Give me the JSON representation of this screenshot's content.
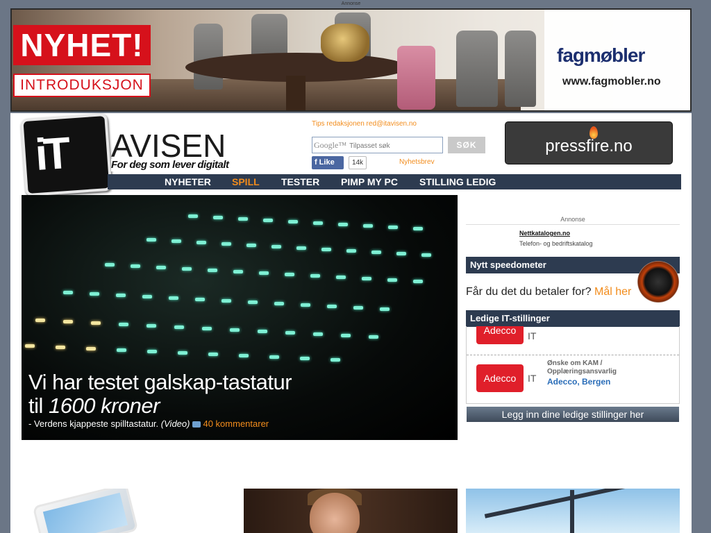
{
  "top_ad_label": "Annonse",
  "banner": {
    "headline": "NYHET!",
    "tagline": "INTRODUKSJON",
    "brand": "fagmøbler",
    "url": "www.fagmobler.no"
  },
  "header": {
    "logo_main": "AVISEN",
    "logo_it": "iT",
    "slogan": "For deg som lever digitalt",
    "tips": "Tips redaksjonen red@itavisen.no",
    "search_google": "Google™",
    "search_placeholder": "Tilpasset søk",
    "search_button": "SØK",
    "like_label": "Like",
    "like_count": "14k",
    "newsletter": "Nyhetsbrev",
    "pressfire": "pressfire.no"
  },
  "nav": {
    "items": [
      {
        "label": "NYHETER",
        "active": false
      },
      {
        "label": "SPILL",
        "active": true
      },
      {
        "label": "TESTER",
        "active": false
      },
      {
        "label": "PIMP MY PC",
        "active": false
      },
      {
        "label": "STILLING LEDIG",
        "active": false
      }
    ]
  },
  "hero": {
    "title_line1": "Vi har testet galskap-tastatur",
    "title_line2_prefix": "til ",
    "title_line2_em": "1600 kroner",
    "subtitle": "- Verdens kjappeste spilltastatur.",
    "subtitle_video": "(Video)",
    "comments": "40 kommentarer"
  },
  "sidebar": {
    "annonse_label": "Annonse",
    "nettkatalogen_title": "Nettkatalogen.no",
    "nettkatalogen_desc": "Telefon- og bedriftskatalog",
    "speedometer_header": "Nytt speedometer",
    "speedometer_text": "Får du det du betaler for?",
    "speedometer_link": "Mål her",
    "jobs_header": "Ledige IT-stillinger",
    "jobs": [
      {
        "logo": "Adecco",
        "suffix": "IT"
      },
      {
        "logo": "Adecco",
        "suffix": "IT",
        "title_line1": "Ønske om KAM /",
        "title_line2": "Opplæringsansvarlig",
        "company": "Adecco, Bergen"
      }
    ],
    "jobs_button": "Legg inn dine ledige stillinger her"
  },
  "colors": {
    "accent": "#f28c1c",
    "nav_bg": "#2d3b50",
    "brand_red": "#d6111b",
    "job_link": "#2a6db8"
  }
}
